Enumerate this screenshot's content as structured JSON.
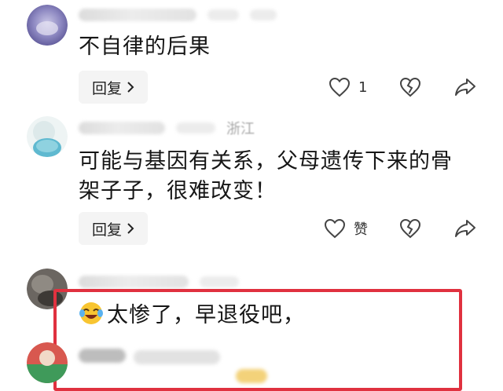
{
  "comments": [
    {
      "text": "不自律的后果",
      "reply_label": "回复",
      "like_count": "1"
    },
    {
      "meta_location": "浙江",
      "text_line1": "可能与基因有关系，父母遗传下来的骨",
      "text_line2": "架子子，很难改变！",
      "reply_label": "回复",
      "like_label": "赞"
    },
    {
      "text": "太惨了，早退役吧，"
    }
  ],
  "icons": {
    "like": "heart-outline-icon",
    "dislike": "broken-heart-icon",
    "share": "share-arrow-icon",
    "reply_chevron": "chevron-right-icon",
    "emoji": "crying-laughing-emoji-icon"
  },
  "colors": {
    "highlight_box": "#e0313f",
    "reply_bg": "#f4f4f4",
    "text": "#161616",
    "muted": "#b9b9b9"
  }
}
